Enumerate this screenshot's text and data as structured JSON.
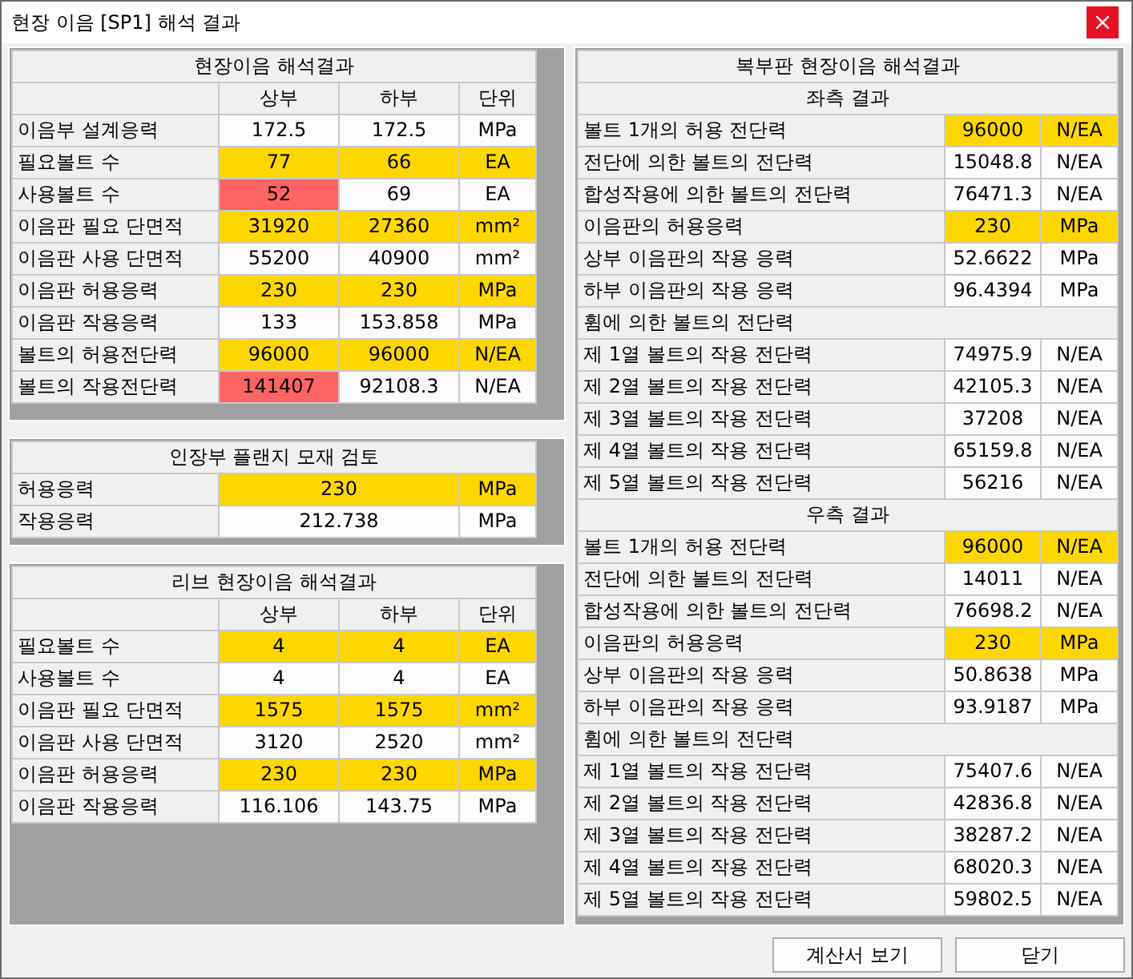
{
  "window": {
    "title": "현장 이음 [SP1] 해석 결과"
  },
  "splice_table": {
    "title": "현장이음 해석결과",
    "columns": [
      "상부",
      "하부",
      "단위"
    ],
    "rows": [
      {
        "label": "이음부 설계응력",
        "cells": [
          {
            "text": "172.5"
          },
          {
            "text": "172.5"
          },
          {
            "text": "MPa"
          }
        ]
      },
      {
        "label": "필요볼트 수",
        "cells": [
          {
            "text": "77",
            "color": "#ffd700"
          },
          {
            "text": "66",
            "color": "#ffd700"
          },
          {
            "text": "EA",
            "color": "#ffd700"
          }
        ]
      },
      {
        "label": "사용볼트 수",
        "cells": [
          {
            "text": "52",
            "color": "#ff6464"
          },
          {
            "text": "69"
          },
          {
            "text": "EA"
          }
        ]
      },
      {
        "label": "이음판 필요 단면적",
        "cells": [
          {
            "text": "31920",
            "color": "#ffd700"
          },
          {
            "text": "27360",
            "color": "#ffd700"
          },
          {
            "text": "mm²",
            "color": "#ffd700"
          }
        ]
      },
      {
        "label": "이음판 사용 단면적",
        "cells": [
          {
            "text": "55200"
          },
          {
            "text": "40900"
          },
          {
            "text": "mm²"
          }
        ]
      },
      {
        "label": "이음판 허용응력",
        "cells": [
          {
            "text": "230",
            "color": "#ffd700"
          },
          {
            "text": "230",
            "color": "#ffd700"
          },
          {
            "text": "MPa",
            "color": "#ffd700"
          }
        ]
      },
      {
        "label": "이음판 작용응력",
        "cells": [
          {
            "text": "133"
          },
          {
            "text": "153.858"
          },
          {
            "text": "MPa"
          }
        ]
      },
      {
        "label": "볼트의 허용전단력",
        "cells": [
          {
            "text": "96000",
            "color": "#ffd700"
          },
          {
            "text": "96000",
            "color": "#ffd700"
          },
          {
            "text": "N/EA",
            "color": "#ffd700"
          }
        ]
      },
      {
        "label": "볼트의 작용전단력",
        "cells": [
          {
            "text": "141407",
            "color": "#ff6464"
          },
          {
            "text": "92108.3"
          },
          {
            "text": "N/EA"
          }
        ]
      }
    ]
  },
  "flange_table": {
    "title": "인장부 플랜지 모재 검토",
    "rows": [
      {
        "label": "허용응력",
        "cells": [
          {
            "text": "230",
            "color": "#ffd700"
          },
          {
            "text": "MPa",
            "color": "#ffd700"
          }
        ]
      },
      {
        "label": "작용응력",
        "cells": [
          {
            "text": "212.738"
          },
          {
            "text": "MPa"
          }
        ]
      }
    ]
  },
  "rib_table": {
    "title": "리브 현장이음 해석결과",
    "columns": [
      "상부",
      "하부",
      "단위"
    ],
    "rows": [
      {
        "label": "필요볼트 수",
        "cells": [
          {
            "text": "4",
            "color": "#ffd700"
          },
          {
            "text": "4",
            "color": "#ffd700"
          },
          {
            "text": "EA",
            "color": "#ffd700"
          }
        ]
      },
      {
        "label": "사용볼트 수",
        "cells": [
          {
            "text": "4"
          },
          {
            "text": "4"
          },
          {
            "text": "EA"
          }
        ]
      },
      {
        "label": "이음판 필요 단면적",
        "cells": [
          {
            "text": "1575",
            "color": "#ffd700"
          },
          {
            "text": "1575",
            "color": "#ffd700"
          },
          {
            "text": "mm²",
            "color": "#ffd700"
          }
        ]
      },
      {
        "label": "이음판 사용 단면적",
        "cells": [
          {
            "text": "3120"
          },
          {
            "text": "2520"
          },
          {
            "text": "mm²"
          }
        ]
      },
      {
        "label": "이음판 허용응력",
        "cells": [
          {
            "text": "230",
            "color": "#ffd700"
          },
          {
            "text": "230",
            "color": "#ffd700"
          },
          {
            "text": "MPa",
            "color": "#ffd700"
          }
        ]
      },
      {
        "label": "이음판 작용응력",
        "cells": [
          {
            "text": "116.106"
          },
          {
            "text": "143.75"
          },
          {
            "text": "MPa"
          }
        ]
      }
    ]
  },
  "web_table": {
    "title": "복부판 현장이음 해석결과",
    "sections": [
      {
        "title": "좌측 결과",
        "items": [
          {
            "kind": "row",
            "label": "볼트 1개의 허용 전단력",
            "cells": [
              {
                "text": "96000",
                "color": "#ffd700"
              },
              {
                "text": "N/EA",
                "color": "#ffd700"
              }
            ]
          },
          {
            "kind": "row",
            "label": "전단에 의한 볼트의 전단력",
            "cells": [
              {
                "text": "15048.8"
              },
              {
                "text": "N/EA"
              }
            ]
          },
          {
            "kind": "row",
            "label": "합성작용에 의한 볼트의 전단력",
            "cells": [
              {
                "text": "76471.3"
              },
              {
                "text": "N/EA"
              }
            ]
          },
          {
            "kind": "row",
            "label": "이음판의 허용응력",
            "cells": [
              {
                "text": "230",
                "color": "#ffd700"
              },
              {
                "text": "MPa",
                "color": "#ffd700"
              }
            ]
          },
          {
            "kind": "row",
            "label": "상부 이음판의 작용 응력",
            "cells": [
              {
                "text": "52.6622"
              },
              {
                "text": "MPa"
              }
            ]
          },
          {
            "kind": "row",
            "label": "하부 이음판의 작용 응력",
            "cells": [
              {
                "text": "96.4394"
              },
              {
                "text": "MPa"
              }
            ]
          },
          {
            "kind": "heading",
            "label": "휨에 의한 볼트의 전단력"
          },
          {
            "kind": "row",
            "label": "제 1열 볼트의 작용 전단력",
            "cells": [
              {
                "text": "74975.9"
              },
              {
                "text": "N/EA"
              }
            ]
          },
          {
            "kind": "row",
            "label": "제 2열 볼트의 작용 전단력",
            "cells": [
              {
                "text": "42105.3"
              },
              {
                "text": "N/EA"
              }
            ]
          },
          {
            "kind": "row",
            "label": "제 3열 볼트의 작용 전단력",
            "cells": [
              {
                "text": "37208"
              },
              {
                "text": "N/EA"
              }
            ]
          },
          {
            "kind": "row",
            "label": "제 4열 볼트의 작용 전단력",
            "cells": [
              {
                "text": "65159.8"
              },
              {
                "text": "N/EA"
              }
            ]
          },
          {
            "kind": "row",
            "label": "제 5열 볼트의 작용 전단력",
            "cells": [
              {
                "text": "56216"
              },
              {
                "text": "N/EA"
              }
            ]
          }
        ]
      },
      {
        "title": "우측 결과",
        "items": [
          {
            "kind": "row",
            "label": "볼트 1개의 허용 전단력",
            "cells": [
              {
                "text": "96000",
                "color": "#ffd700"
              },
              {
                "text": "N/EA",
                "color": "#ffd700"
              }
            ]
          },
          {
            "kind": "row",
            "label": "전단에 의한 볼트의 전단력",
            "cells": [
              {
                "text": "14011"
              },
              {
                "text": "N/EA"
              }
            ]
          },
          {
            "kind": "row",
            "label": "합성작용에 의한 볼트의 전단력",
            "cells": [
              {
                "text": "76698.2"
              },
              {
                "text": "N/EA"
              }
            ]
          },
          {
            "kind": "row",
            "label": "이음판의 허용응력",
            "cells": [
              {
                "text": "230",
                "color": "#ffd700"
              },
              {
                "text": "MPa",
                "color": "#ffd700"
              }
            ]
          },
          {
            "kind": "row",
            "label": "상부 이음판의 작용 응력",
            "cells": [
              {
                "text": "50.8638"
              },
              {
                "text": "MPa"
              }
            ]
          },
          {
            "kind": "row",
            "label": "하부 이음판의 작용 응력",
            "cells": [
              {
                "text": "93.9187"
              },
              {
                "text": "MPa"
              }
            ]
          },
          {
            "kind": "heading",
            "label": "휨에 의한 볼트의 전단력"
          },
          {
            "kind": "row",
            "label": "제 1열 볼트의 작용 전단력",
            "cells": [
              {
                "text": "75407.6"
              },
              {
                "text": "N/EA"
              }
            ]
          },
          {
            "kind": "row",
            "label": "제 2열 볼트의 작용 전단력",
            "cells": [
              {
                "text": "42836.8"
              },
              {
                "text": "N/EA"
              }
            ]
          },
          {
            "kind": "row",
            "label": "제 3열 볼트의 작용 전단력",
            "cells": [
              {
                "text": "38287.2"
              },
              {
                "text": "N/EA"
              }
            ]
          },
          {
            "kind": "row",
            "label": "제 4열 볼트의 작용 전단력",
            "cells": [
              {
                "text": "68020.3"
              },
              {
                "text": "N/EA"
              }
            ]
          },
          {
            "kind": "row",
            "label": "제 5열 볼트의 작용 전단력",
            "cells": [
              {
                "text": "59802.5"
              },
              {
                "text": "N/EA"
              }
            ]
          }
        ]
      }
    ]
  },
  "buttons": [
    "계산서 보기",
    "닫기"
  ]
}
